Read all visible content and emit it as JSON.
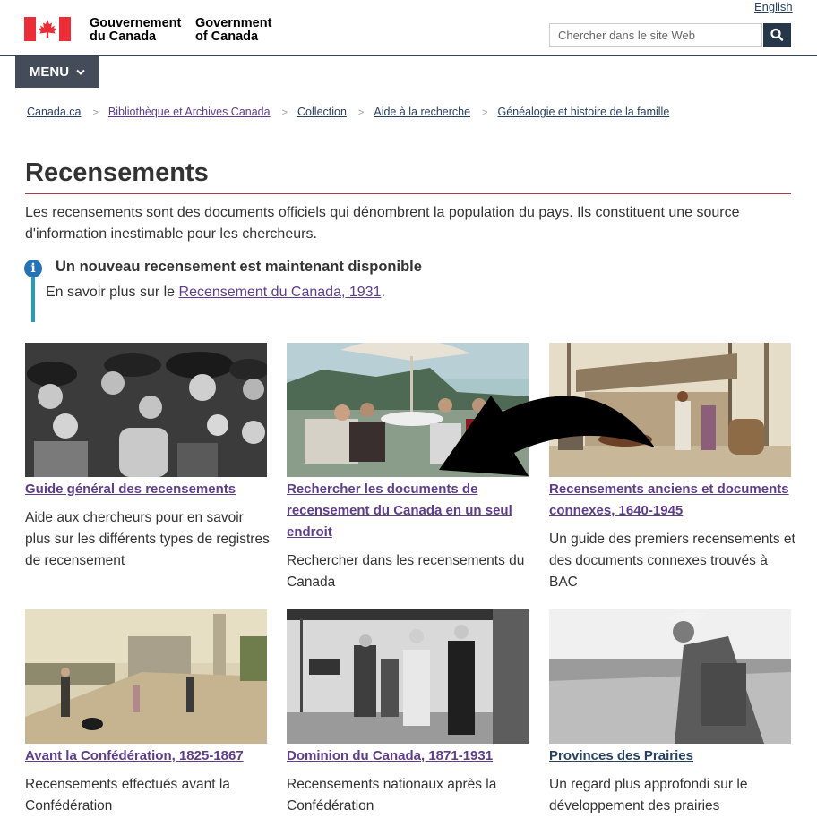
{
  "header": {
    "lang_link": "English",
    "wordmark_fr": [
      "Gouvernement",
      "du Canada"
    ],
    "wordmark_en": [
      "Government",
      "of Canada"
    ],
    "search_placeholder": "Chercher dans le site Web",
    "menu_label": "MENU"
  },
  "breadcrumb": [
    "Canada.ca",
    "Bibliothèque et Archives Canada",
    "Collection",
    "Aide à la recherche",
    "Généalogie et histoire de la famille"
  ],
  "page": {
    "title": "Recensements",
    "intro": "Les recensements sont des documents officiels qui dénombrent la population du pays. Ils constituent une source d'information inestimable pour les chercheurs."
  },
  "alert": {
    "title": "Un nouveau recensement est maintenant disponible",
    "body_prefix": "En savoir plus sur le ",
    "link": "Recensement du Canada, 1931",
    "body_suffix": "."
  },
  "cards": [
    {
      "title": "Guide général des recensements",
      "desc": "Aide aux chercheurs pour en savoir plus sur les différents types de registres de recensement"
    },
    {
      "title": "Rechercher les documents de recensement du Canada en un seul endroit",
      "desc": "Rechercher dans les recensements du Canada"
    },
    {
      "title": "Recensements anciens et documents connexes, 1640-1945",
      "desc": "Un guide des premiers recensements et des documents connexes trouvés à BAC"
    },
    {
      "title": "Avant la Confédération, 1825-1867",
      "desc": "Recensements effectués avant la Confédération"
    },
    {
      "title": "Dominion du Canada, 1871-1931",
      "desc": "Recensements nationaux après la Confédération"
    },
    {
      "title": "Provinces des Prairies",
      "desc": "Un regard plus approfondi sur le développement des prairies"
    }
  ],
  "icons": {
    "search": "search-icon",
    "menu_chevron": "chevron-down-icon",
    "alert": "info-icon",
    "flag": "canada-flag-icon"
  }
}
